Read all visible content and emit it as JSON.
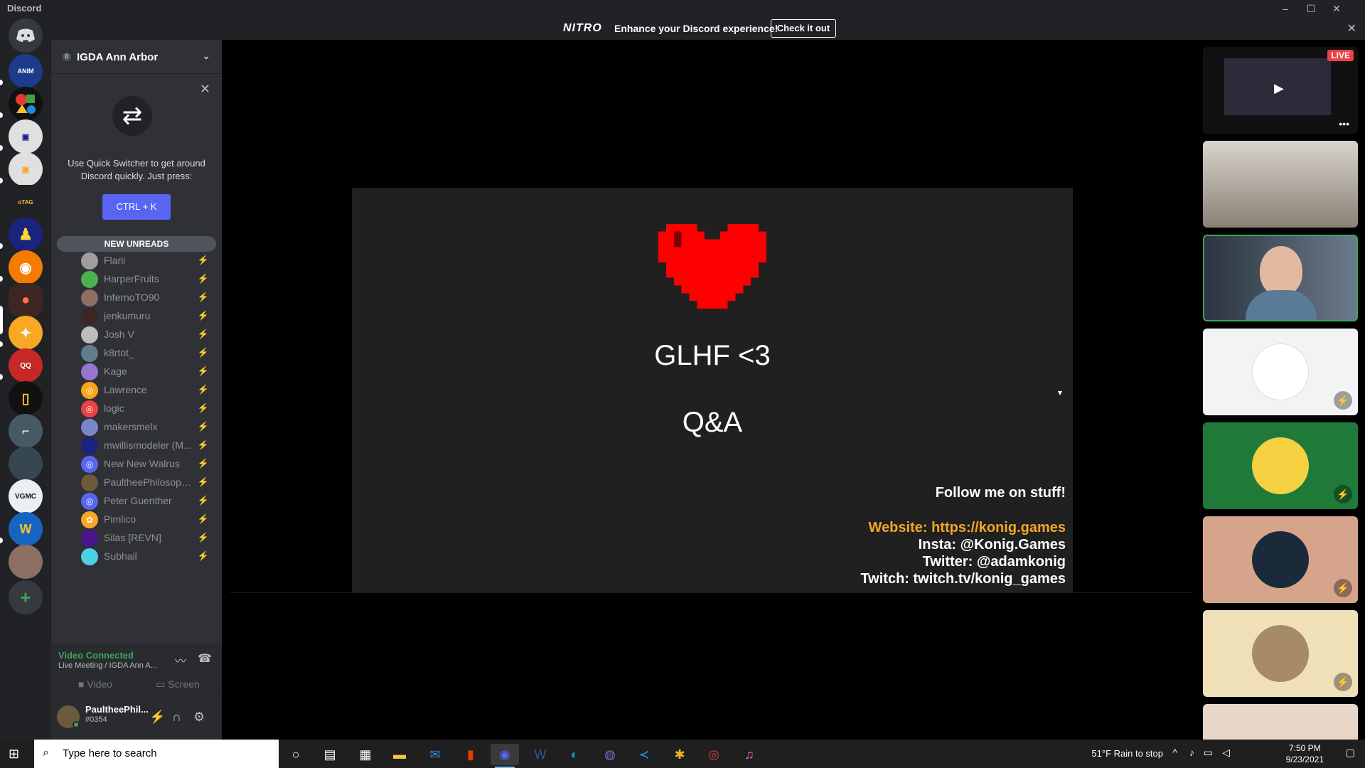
{
  "window": {
    "title": "Discord"
  },
  "nitro": {
    "logo": "NITRO",
    "text": "Enhance your Discord experience!",
    "button": "Check it out"
  },
  "guild": {
    "name": "IGDA Ann Arbor",
    "boost_count": "0"
  },
  "quick_switcher": {
    "description": "Use Quick Switcher to get around Discord quickly. Just press:",
    "shortcut": "CTRL + K"
  },
  "unreads_label": "NEW UNREADS",
  "members": [
    {
      "name": "Flarii"
    },
    {
      "name": "HarperFruits"
    },
    {
      "name": "InfernoTO90"
    },
    {
      "name": "jenkumuru"
    },
    {
      "name": "Josh V"
    },
    {
      "name": "k8rtot_"
    },
    {
      "name": "Kage"
    },
    {
      "name": "Lawrence"
    },
    {
      "name": "logic"
    },
    {
      "name": "makersmelx"
    },
    {
      "name": "mwillismodeler (M..."
    },
    {
      "name": "New New Walrus"
    },
    {
      "name": "PaultheePhilosophy..."
    },
    {
      "name": "Peter Guenther"
    },
    {
      "name": "Pimlico"
    },
    {
      "name": "Silas [REVN]"
    },
    {
      "name": "Subhail"
    }
  ],
  "voice": {
    "status": "Video Connected",
    "channel": "Live Meeting / IGDA Ann A...",
    "video_label": "Video",
    "screen_label": "Screen"
  },
  "user": {
    "name": "PaultheePhil...",
    "tag": "#0354"
  },
  "slide": {
    "title1": "GLHF <3",
    "title2": "Q&A",
    "follow": "Follow me on stuff!",
    "website": "Website: https://konig.games",
    "insta": "Insta: @Konig.Games",
    "twitter": "Twitter: @adamkonig",
    "twitch": "Twitch: twitch.tv/konig_games"
  },
  "tiles": {
    "live_badge": "LIVE"
  },
  "taskbar": {
    "search_placeholder": "Type here to search",
    "weather": "51°F  Rain to stop",
    "time": "7:50 PM",
    "date": "9/23/2021"
  },
  "colors": {
    "accent": "#5865f2",
    "connected": "#3ba55d",
    "live": "#ed4245",
    "website": "#f5a623"
  }
}
